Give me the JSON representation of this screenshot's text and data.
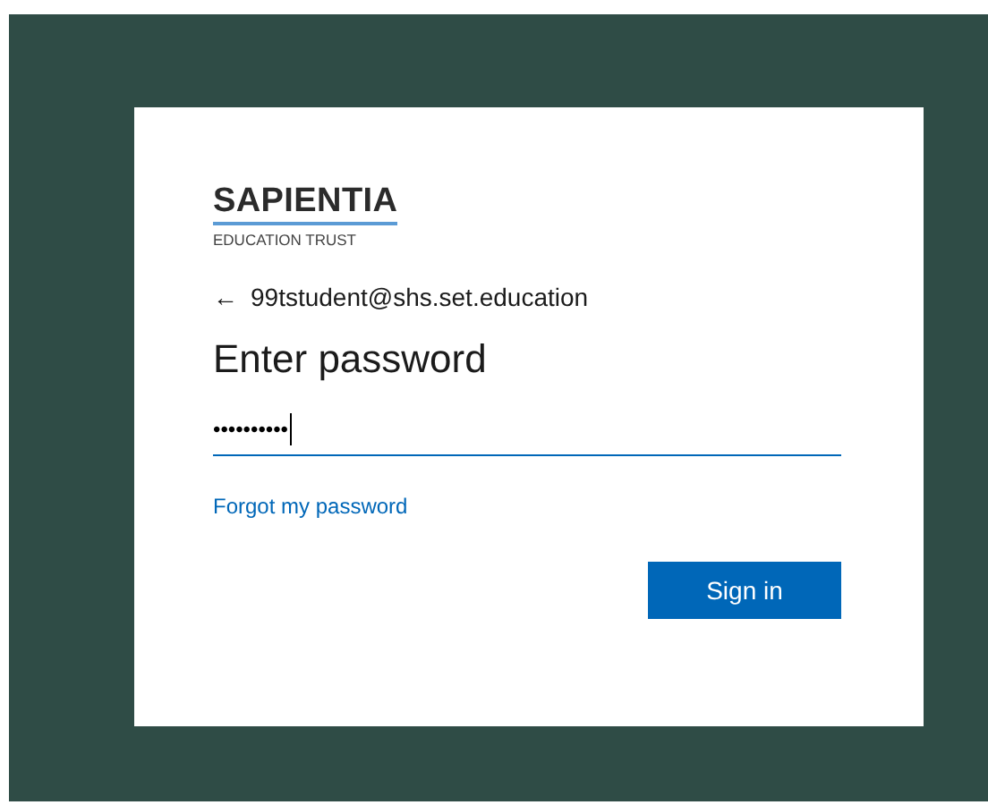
{
  "logo": {
    "name": "SAPIENTIA",
    "tagline": "EDUCATION TRUST"
  },
  "back": {
    "icon": "←",
    "account": "99tstudent@shs.set.education"
  },
  "title": "Enter password",
  "password": {
    "value": "••••••••••",
    "focused": true
  },
  "forgot_link": "Forgot my password",
  "buttons": [
    "Sign in"
  ]
}
